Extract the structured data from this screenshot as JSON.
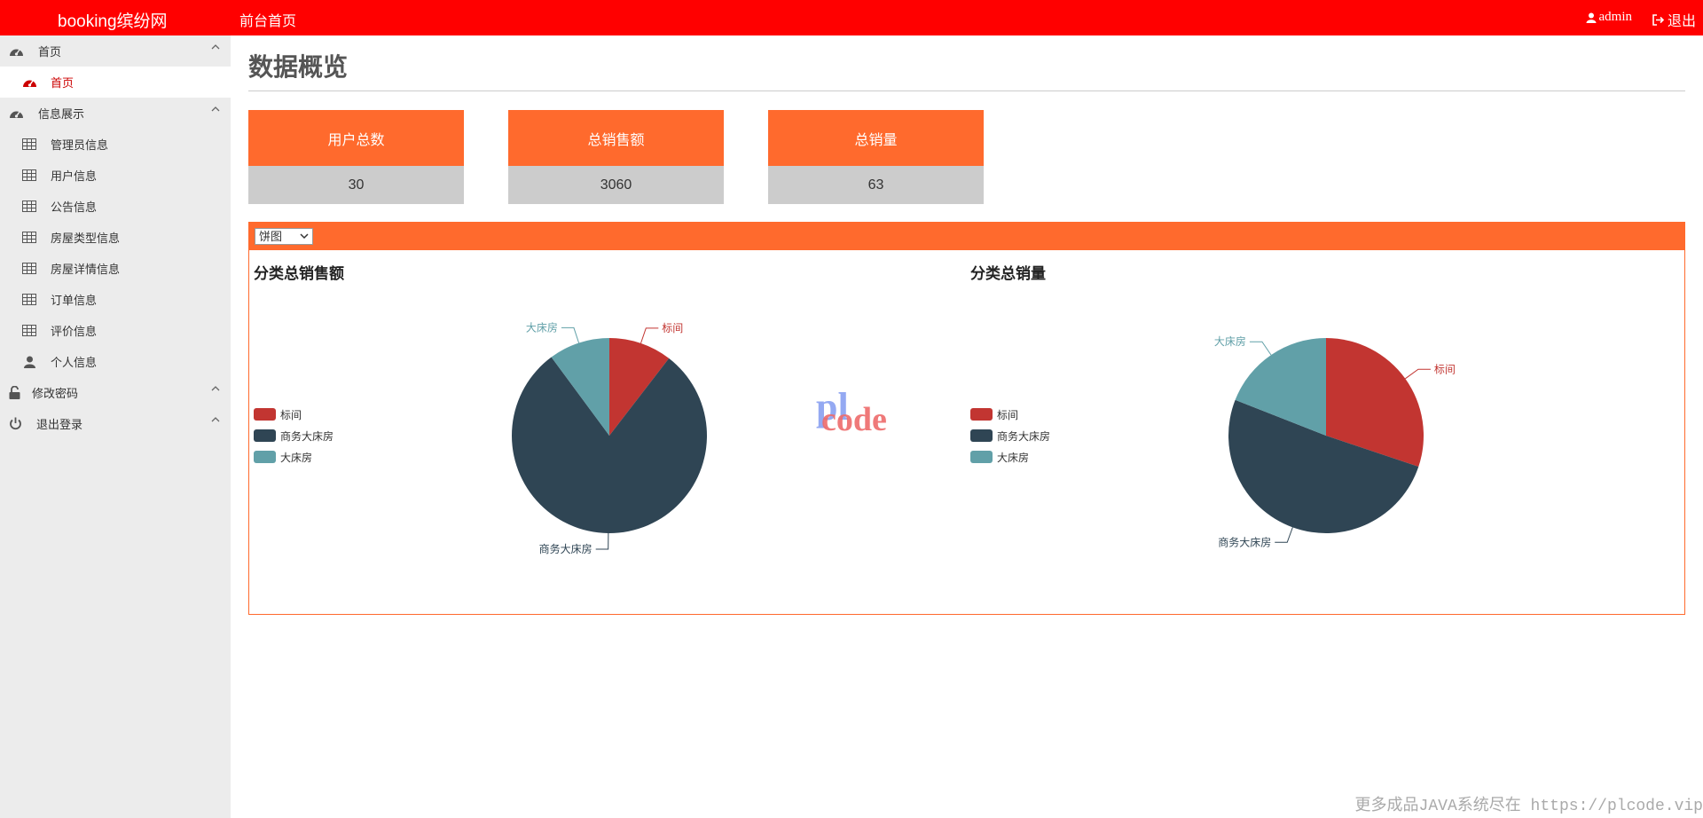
{
  "header": {
    "brand": "booking缤纷网",
    "home_link": "前台首页",
    "user": "admin",
    "logout": "退出"
  },
  "sidebar": {
    "items": [
      {
        "label": "首页",
        "icon": "dashboard-icon",
        "type": "group"
      },
      {
        "label": "首页",
        "icon": "dashboard-icon",
        "type": "sub",
        "active": true
      },
      {
        "label": "信息展示",
        "icon": "dashboard-icon",
        "type": "group"
      },
      {
        "label": "管理员信息",
        "icon": "table-icon",
        "type": "sub"
      },
      {
        "label": "用户信息",
        "icon": "table-icon",
        "type": "sub"
      },
      {
        "label": "公告信息",
        "icon": "table-icon",
        "type": "sub"
      },
      {
        "label": "房屋类型信息",
        "icon": "table-icon",
        "type": "sub"
      },
      {
        "label": "房屋详情信息",
        "icon": "table-icon",
        "type": "sub"
      },
      {
        "label": "订单信息",
        "icon": "table-icon",
        "type": "sub"
      },
      {
        "label": "评价信息",
        "icon": "table-icon",
        "type": "sub"
      },
      {
        "label": "个人信息",
        "icon": "user-icon",
        "type": "sub"
      },
      {
        "label": "修改密码",
        "icon": "unlock-icon",
        "type": "group"
      },
      {
        "label": "退出登录",
        "icon": "power-icon",
        "type": "group"
      }
    ]
  },
  "page_title": "数据概览",
  "stats": [
    {
      "label": "用户总数",
      "value": "30"
    },
    {
      "label": "总销售额",
      "value": "3060"
    },
    {
      "label": "总销量",
      "value": "63"
    }
  ],
  "chart_select": {
    "value": "饼图"
  },
  "colors": {
    "topbar": "#ff0000",
    "accent": "#ff6a2d"
  },
  "chart_data": [
    {
      "type": "pie",
      "title": "分类总销售额",
      "categories": [
        "标间",
        "商务大床房",
        "大床房"
      ],
      "values": [
        320,
        2430,
        310
      ],
      "colors": [
        "#c23531",
        "#2f4554",
        "#61a0a8"
      ],
      "legend": "left"
    },
    {
      "type": "pie",
      "title": "分类总销量",
      "categories": [
        "标间",
        "商务大床房",
        "大床房"
      ],
      "values": [
        19,
        32,
        12
      ],
      "colors": [
        "#c23531",
        "#2f4554",
        "#61a0a8"
      ],
      "legend": "left"
    }
  ],
  "watermark": {
    "top": "pl",
    "bottom": "code"
  },
  "footer_note": "更多成品JAVA系统尽在 https://plcode.vip"
}
